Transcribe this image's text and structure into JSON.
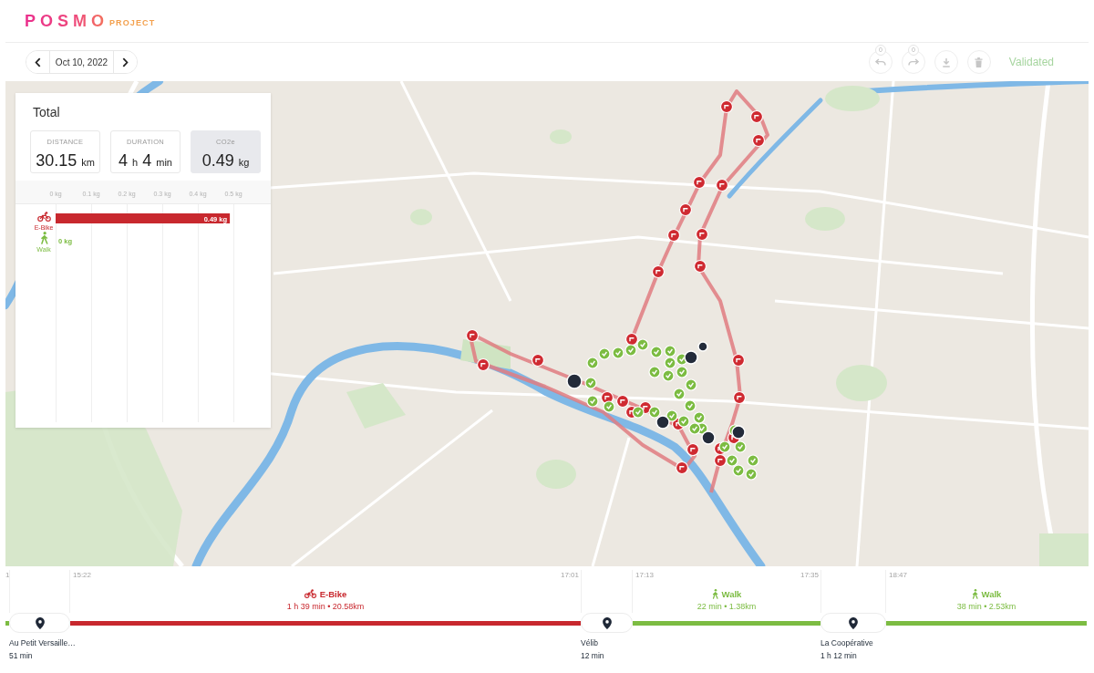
{
  "header": {
    "logo": {
      "brand": "POSMO",
      "product": "PROJECT"
    }
  },
  "toolbar": {
    "date": "Oct 10, 2022",
    "actions": [
      {
        "kind": "undo",
        "badge": "0",
        "disabled": true
      },
      {
        "kind": "redo",
        "badge": "0",
        "disabled": true
      },
      {
        "kind": "download",
        "disabled": true
      },
      {
        "kind": "delete",
        "disabled": true
      }
    ],
    "status_button": {
      "label": "Validated",
      "disabled": true
    }
  },
  "summary_panel": {
    "title": "Total",
    "stats": [
      {
        "label": "DISTANCE",
        "selected": false,
        "parts": [
          {
            "kind": "number",
            "text": "30.15"
          },
          {
            "kind": "unit",
            "text": "km"
          }
        ]
      },
      {
        "label": "DURATION",
        "selected": false,
        "parts": [
          {
            "kind": "number",
            "text": "4"
          },
          {
            "kind": "unit",
            "text": "h"
          },
          {
            "kind": "number",
            "text": "4"
          },
          {
            "kind": "unit",
            "text": "min"
          }
        ]
      },
      {
        "label": "CO2e",
        "selected": true,
        "parts": [
          {
            "kind": "number",
            "text": "0.49"
          },
          {
            "kind": "unit",
            "text": "kg"
          }
        ]
      }
    ],
    "category_icons": [
      {
        "kind": "ebike"
      },
      {
        "kind": "walk"
      }
    ],
    "chart_data": {
      "type": "bar",
      "orientation": "horizontal",
      "stacked": true,
      "grid": true,
      "categories": [
        "E-Bike",
        "Walk"
      ],
      "series": [
        {
          "color": "#c8282e",
          "values": [
            0.49,
            null
          ]
        },
        {
          "color": "#7cbc42",
          "values": [
            null,
            0
          ]
        }
      ],
      "xlim": [
        0,
        0.6
      ],
      "xticks": [
        {
          "value": 0,
          "label": "0 kg"
        },
        {
          "value": 0.1,
          "label": "0.1 kg"
        },
        {
          "value": 0.2,
          "label": "0.2 kg"
        },
        {
          "value": 0.3,
          "label": "0.3 kg"
        },
        {
          "value": 0.4,
          "label": "0.4 kg"
        },
        {
          "value": 0.5,
          "label": "0.5 kg"
        }
      ],
      "value_labels": [
        "0.49 kg",
        "0 kg"
      ]
    }
  },
  "timeline": {
    "items": [
      {
        "kind": "walk",
        "start_time": "1"
      },
      {
        "kind": "stop",
        "name": "Au Petit Versaille…",
        "duration": "51 min"
      },
      {
        "kind": "ebike",
        "label": "E-Bike",
        "stats": "1 h 39 min • 20.58km",
        "start_time": "15:22",
        "end_time": "17:01"
      },
      {
        "kind": "stop",
        "name": "Vélib",
        "duration": "12 min"
      },
      {
        "kind": "walk",
        "label": "Walk",
        "stats": "22 min • 1.38km",
        "start_time": "17:13",
        "end_time": "17:35"
      },
      {
        "kind": "stop",
        "name": "La Coopérative",
        "duration": "1 h 12 min"
      },
      {
        "kind": "walk",
        "label": "Walk",
        "stats": "38 min • 2.53km",
        "start_time": "18:47"
      }
    ]
  }
}
